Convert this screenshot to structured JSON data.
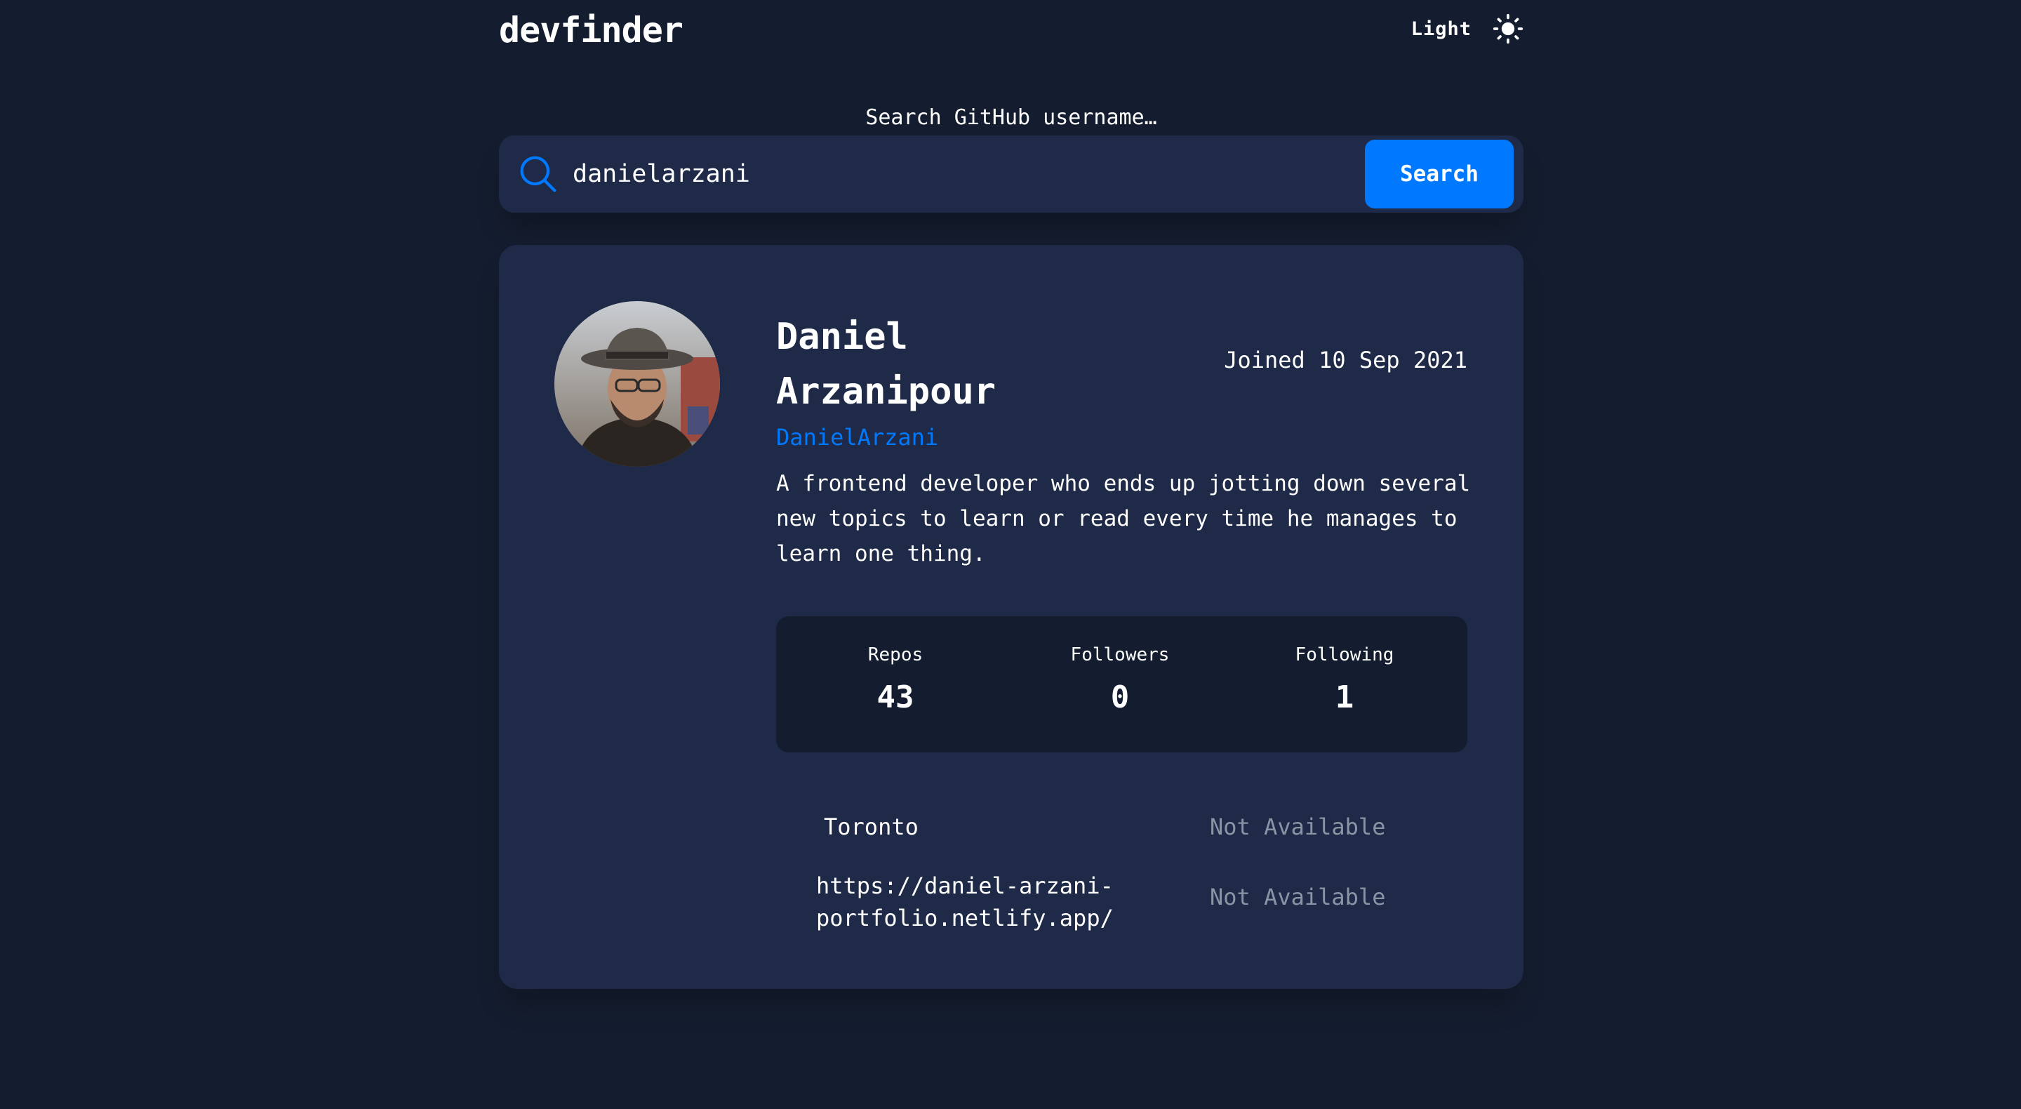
{
  "header": {
    "logo": "devfinder",
    "theme_label": "Light",
    "theme_icon": "sun-icon"
  },
  "search": {
    "caption": "Search GitHub username…",
    "value": "danielarzani",
    "placeholder": "",
    "button_label": "Search",
    "icon": "search-icon"
  },
  "profile": {
    "name": "Daniel Arzanipour",
    "login": "DanielArzani",
    "joined": "Joined 10 Sep 2021",
    "bio": "A frontend developer who ends up jotting down several new topics to learn or read every time he manages to learn one thing.",
    "avatar_alt": "avatar",
    "stats": [
      {
        "label": "Repos",
        "value": "43"
      },
      {
        "label": "Followers",
        "value": "0"
      },
      {
        "label": "Following",
        "value": "1"
      }
    ],
    "links": {
      "location": "Toronto",
      "twitter": "Not Available",
      "blog": "https://daniel-arzani-portfolio.netlify.app/",
      "company": "Not Available"
    }
  },
  "colors": {
    "background": "#141d2f",
    "card": "#1e2a47",
    "accent": "#0079ff",
    "muted": "#8b94a5"
  }
}
